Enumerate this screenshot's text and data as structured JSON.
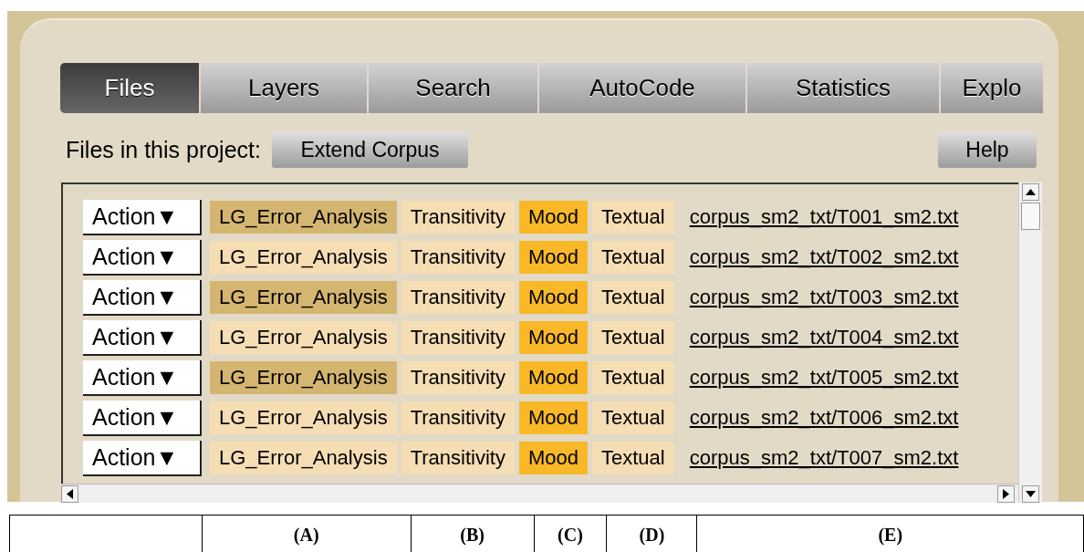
{
  "tabs": [
    {
      "label": "Files",
      "selected": true
    },
    {
      "label": "Layers",
      "selected": false
    },
    {
      "label": "Search",
      "selected": false
    },
    {
      "label": "AutoCode",
      "selected": false
    },
    {
      "label": "Statistics",
      "selected": false
    },
    {
      "label": "Explo",
      "selected": false
    }
  ],
  "toolbar": {
    "label": "Files in this project:",
    "extend_button": "Extend Corpus",
    "help_button": "Help"
  },
  "files": [
    {
      "action": "Action▼",
      "layers": [
        {
          "label": "LG_Error_Analysis",
          "color": "#d4b670"
        },
        {
          "label": "Transitivity",
          "color": "#f5ddb4"
        },
        {
          "label": "Mood",
          "color": "#f8b828"
        },
        {
          "label": "Textual",
          "color": "#f5ddb4"
        }
      ],
      "path": "corpus_sm2_txt/T001_sm2.txt"
    },
    {
      "action": "Action▼",
      "layers": [
        {
          "label": "LG_Error_Analysis",
          "color": "#f5ddb4"
        },
        {
          "label": "Transitivity",
          "color": "#f5ddb4"
        },
        {
          "label": "Mood",
          "color": "#f8b828"
        },
        {
          "label": "Textual",
          "color": "#f5ddb4"
        }
      ],
      "path": "corpus_sm2_txt/T002_sm2.txt"
    },
    {
      "action": "Action▼",
      "layers": [
        {
          "label": "LG_Error_Analysis",
          "color": "#d4b670"
        },
        {
          "label": "Transitivity",
          "color": "#f5ddb4"
        },
        {
          "label": "Mood",
          "color": "#f8b828"
        },
        {
          "label": "Textual",
          "color": "#f5ddb4"
        }
      ],
      "path": "corpus_sm2_txt/T003_sm2.txt"
    },
    {
      "action": "Action▼",
      "layers": [
        {
          "label": "LG_Error_Analysis",
          "color": "#f5ddb4"
        },
        {
          "label": "Transitivity",
          "color": "#f5ddb4"
        },
        {
          "label": "Mood",
          "color": "#f8b828"
        },
        {
          "label": "Textual",
          "color": "#f5ddb4"
        }
      ],
      "path": "corpus_sm2_txt/T004_sm2.txt"
    },
    {
      "action": "Action▼",
      "layers": [
        {
          "label": "LG_Error_Analysis",
          "color": "#d4b670"
        },
        {
          "label": "Transitivity",
          "color": "#f5ddb4"
        },
        {
          "label": "Mood",
          "color": "#f8b828"
        },
        {
          "label": "Textual",
          "color": "#f5ddb4"
        }
      ],
      "path": "corpus_sm2_txt/T005_sm2.txt"
    },
    {
      "action": "Action▼",
      "layers": [
        {
          "label": "LG_Error_Analysis",
          "color": "#f5ddb4"
        },
        {
          "label": "Transitivity",
          "color": "#f5ddb4"
        },
        {
          "label": "Mood",
          "color": "#f8b828"
        },
        {
          "label": "Textual",
          "color": "#f5ddb4"
        }
      ],
      "path": "corpus_sm2_txt/T006_sm2.txt"
    },
    {
      "action": "Action▼",
      "layers": [
        {
          "label": "LG_Error_Analysis",
          "color": "#f5ddb4"
        },
        {
          "label": "Transitivity",
          "color": "#f5ddb4"
        },
        {
          "label": "Mood",
          "color": "#f8b828"
        },
        {
          "label": "Textual",
          "color": "#f5ddb4"
        }
      ],
      "path": "corpus_sm2_txt/T007_sm2.txt"
    }
  ],
  "legend": {
    "columns": [
      "(A)",
      "(B)",
      "(C)",
      "(D)",
      "(E)"
    ]
  }
}
